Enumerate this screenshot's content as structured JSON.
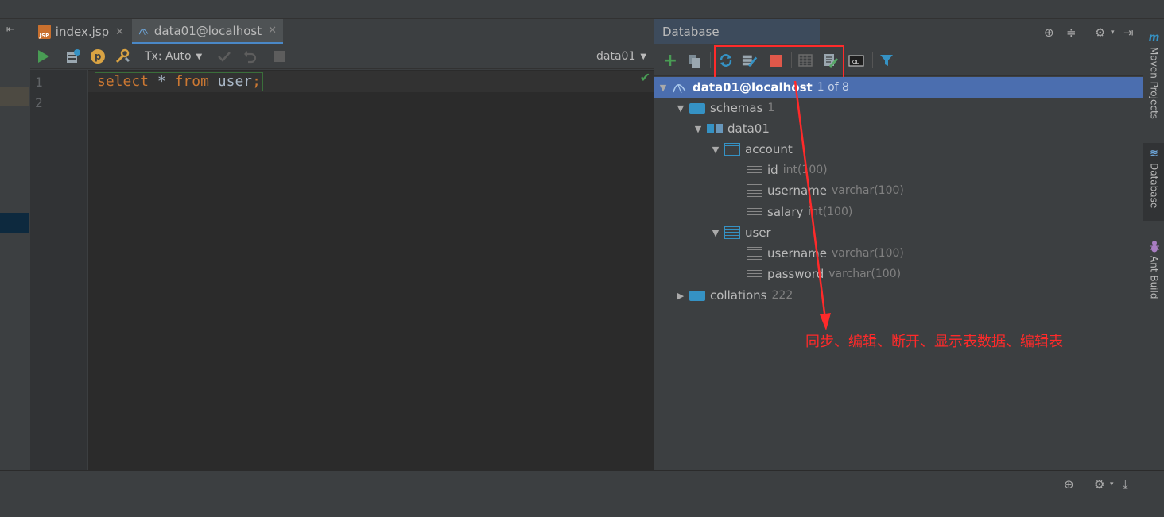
{
  "editor": {
    "tabs": [
      {
        "label": "index.jsp",
        "icon": "jsp-file-icon",
        "badge": "JSP"
      },
      {
        "label": "data01@localhost",
        "icon": "mysql-datasource-icon"
      }
    ],
    "toolbar": {
      "tx_label": "Tx: Auto",
      "datasource": "data01"
    },
    "line_numbers": [
      "1",
      "2"
    ],
    "code": {
      "kw1": "select",
      "star": "*",
      "kw2": "from",
      "table": "user",
      "semi": ";"
    }
  },
  "database": {
    "title": "Database",
    "tree": [
      {
        "name": "data01@localhost",
        "meta": "1 of 8",
        "type": "datasource",
        "level": 0,
        "expanded": true,
        "selected": true
      },
      {
        "name": "schemas",
        "meta": "1",
        "type": "folder",
        "level": 1,
        "expanded": true
      },
      {
        "name": "data01",
        "meta": "",
        "type": "schema",
        "level": 2,
        "expanded": true
      },
      {
        "name": "account",
        "meta": "",
        "type": "table",
        "level": 3,
        "expanded": true
      },
      {
        "name": "id",
        "meta": "int(100)",
        "type": "column",
        "level": 4
      },
      {
        "name": "username",
        "meta": "varchar(100)",
        "type": "column",
        "level": 4
      },
      {
        "name": "salary",
        "meta": "int(100)",
        "type": "column",
        "level": 4
      },
      {
        "name": "user",
        "meta": "",
        "type": "table",
        "level": 3,
        "expanded": true
      },
      {
        "name": "username",
        "meta": "varchar(100)",
        "type": "column",
        "level": 4
      },
      {
        "name": "password",
        "meta": "varchar(100)",
        "type": "column",
        "level": 4
      },
      {
        "name": "collations",
        "meta": "222",
        "type": "folder",
        "level": 1,
        "expanded": false
      }
    ],
    "annotation": "同步、编辑、断开、显示表数据、编辑表"
  },
  "right_tools": [
    {
      "label": "Maven Projects",
      "icon": "m"
    },
    {
      "label": "Database",
      "icon": "≋"
    },
    {
      "label": "Ant Build",
      "icon": "ant-icon"
    }
  ],
  "colors": {
    "selection": "#4b6eaf",
    "annotation": "#ff2a2a",
    "keyword": "#cc7832",
    "run": "#499c54"
  }
}
